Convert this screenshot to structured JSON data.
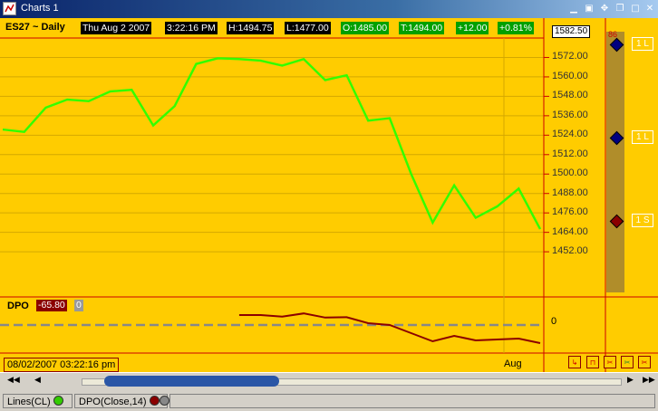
{
  "window": {
    "title": "Charts 1"
  },
  "header": {
    "symbol": "ES27 ~ Daily",
    "date": "Thu Aug 2 2007",
    "time": "3:22:16 PM",
    "high": "H:1494.75",
    "low": "L:1477.00",
    "open": "O:1485.00",
    "trade": "T:1494.00",
    "change": "+12.00",
    "change_pct": "+0.81%"
  },
  "price_axis": {
    "last_price": "1582.50",
    "labels": [
      "1572.00",
      "1560.00",
      "1548.00",
      "1536.00",
      "1524.00",
      "1512.00",
      "1500.00",
      "1488.00",
      "1476.00",
      "1464.00",
      "1452.00"
    ]
  },
  "side_panel": {
    "top_label": "86",
    "badges": [
      {
        "label": "1 L",
        "color": "#000080"
      },
      {
        "label": "1 L",
        "color": "#000080"
      },
      {
        "label": "1 S",
        "color": "#8b0000"
      }
    ]
  },
  "indicator": {
    "name": "DPO",
    "value": "-65.80",
    "value2": "0",
    "zero_label": "0"
  },
  "cursor_date": "08/02/2007 03:22:16 pm",
  "x_axis_label": "Aug",
  "status": {
    "lines": "Lines(CL)",
    "dpo": "DPO(Close,14)"
  },
  "colors": {
    "background": "#ffcc00",
    "price_line": "#33ff00",
    "dpo_line": "#8b0000",
    "axis": "#cc0000"
  },
  "chart_data": {
    "type": "line",
    "series": [
      {
        "values": [
          1527.5,
          1526,
          1541,
          1546,
          1545,
          1551,
          1552,
          1530,
          1542,
          1568,
          1571.5,
          1571,
          1570,
          1567,
          1571,
          1558,
          1561,
          1533,
          1534.5,
          1500,
          1470,
          1493,
          1473,
          1480,
          1491,
          1466
        ]
      }
    ],
    "ylim": [
      1442,
      1584
    ],
    "dpo": {
      "values": [
        null,
        null,
        null,
        null,
        null,
        null,
        null,
        null,
        null,
        null,
        null,
        0.55,
        0.55,
        0.46,
        0.64,
        0.41,
        0.43,
        0.1,
        0,
        -0.45,
        -0.9,
        -0.6,
        -0.85,
        -0.8,
        -0.75,
        -1
      ],
      "zero": 0
    }
  }
}
